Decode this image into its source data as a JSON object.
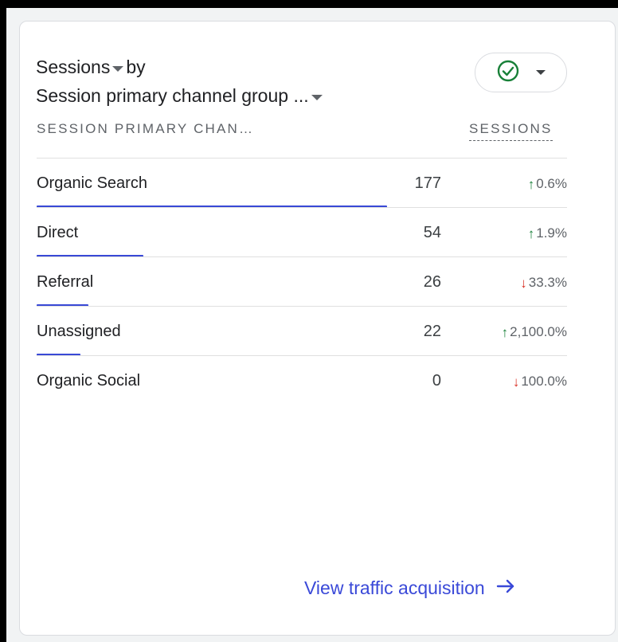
{
  "card": {
    "title_metric": "Sessions",
    "title_by": "by",
    "title_dimension": "Session primary channel group ...",
    "status": {
      "icon": "check-circle-icon",
      "color": "#188038"
    },
    "headers": {
      "dimension": "SESSION PRIMARY CHAN…",
      "metric": "SESSIONS"
    },
    "rows": [
      {
        "label": "Organic Search",
        "value": "177",
        "direction": "up",
        "change": "0.6%",
        "share": 1.0
      },
      {
        "label": "Direct",
        "value": "54",
        "direction": "up",
        "change": "1.9%",
        "share": 0.305
      },
      {
        "label": "Referral",
        "value": "26",
        "direction": "down",
        "change": "33.3%",
        "share": 0.147
      },
      {
        "label": "Unassigned",
        "value": "22",
        "direction": "up",
        "change": "2,100.0%",
        "share": 0.124
      },
      {
        "label": "Organic Social",
        "value": "0",
        "direction": "down",
        "change": "100.0%",
        "share": 0
      }
    ],
    "footer_link": "View traffic acquisition",
    "colors": {
      "bar": "#3949d6",
      "link": "#3a49d8",
      "up": "#188038",
      "down": "#d93025"
    }
  }
}
